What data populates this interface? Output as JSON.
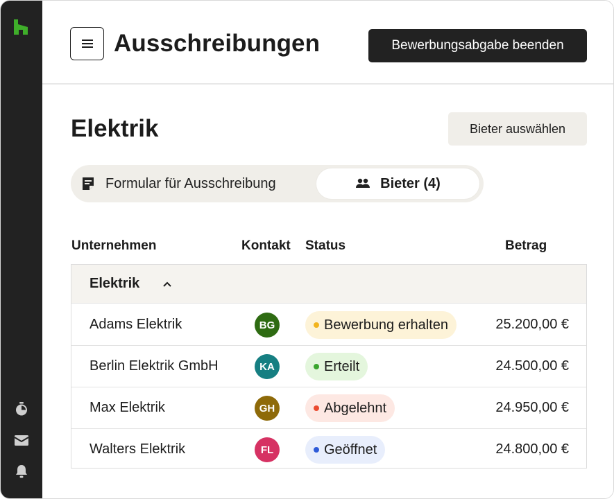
{
  "header": {
    "title": "Ausschreibungen",
    "end_button": "Bewerbungsabgabe beenden"
  },
  "section": {
    "title": "Elektrik",
    "select_button": "Bieter auswählen"
  },
  "tabs": [
    {
      "label": "Formular für Ausschreibung",
      "icon": "document-icon",
      "active": false
    },
    {
      "label": "Bieter (4)",
      "icon": "users-icon",
      "active": true
    }
  ],
  "table": {
    "columns": [
      "Unternehmen",
      "Kontakt",
      "Status",
      "Betrag"
    ],
    "group": "Elektrik",
    "rows": [
      {
        "company": "Adams Elektrik",
        "initials": "BG",
        "avatar_color": "#2e6b12",
        "status": "Bewerbung erhalten",
        "status_bg": "#fdf3d8",
        "status_dot": "#f2b41e",
        "amount": "25.200,00 €"
      },
      {
        "company": "Berlin Elektrik GmbH",
        "initials": "KA",
        "avatar_color": "#167f82",
        "status": "Erteilt",
        "status_bg": "#e4f6dd",
        "status_dot": "#3aa52e",
        "amount": "24.500,00 €"
      },
      {
        "company": "Max Elektrik",
        "initials": "GH",
        "avatar_color": "#8e6a09",
        "status": "Abgelehnt",
        "status_bg": "#fde8e3",
        "status_dot": "#ea4a2f",
        "amount": "24.950,00 €"
      },
      {
        "company": "Walters Elektrik",
        "initials": "FL",
        "avatar_color": "#d63263",
        "status": "Geöffnet",
        "status_bg": "#e8eefc",
        "status_dot": "#2e5bd8",
        "amount": "24.800,00 €"
      }
    ]
  },
  "colors": {
    "brand_green": "#3fae2a",
    "sidebar_bg": "#222222",
    "button_dark": "#222222",
    "surface_beige": "#f0eee9"
  },
  "sidebar_icons": [
    "houzz-logo-icon",
    "timer-icon",
    "inbox-icon",
    "bell-icon"
  ]
}
